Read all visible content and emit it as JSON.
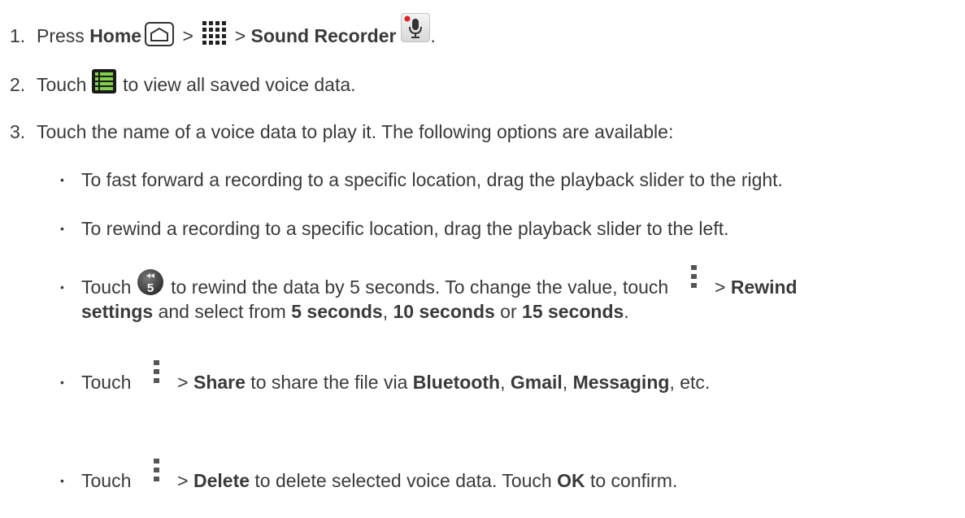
{
  "steps": [
    {
      "num": "1.",
      "t1": "Press ",
      "b1": "Home",
      "t2": " > ",
      "t3": " > ",
      "b2": "Sound Recorder",
      "t4": "."
    },
    {
      "num": "2.",
      "t1": "Touch ",
      "t2": " to view all saved voice data."
    },
    {
      "num": "3.",
      "t1": "Touch the name of a voice data to play it. The following options are available:"
    }
  ],
  "bullet_glyph": "•",
  "bullets": [
    {
      "t1": "To fast forward a recording to a specific location, drag the playback slider to the right."
    },
    {
      "t1": "To rewind a recording to a specific location, drag the playback slider to the left."
    },
    {
      "t1": "Touch ",
      "t2": " to rewind the data by 5 seconds. To change the value, touch ",
      "t3": " > ",
      "b1": "Rewind",
      "b2": "settings",
      "t4": " and select from ",
      "b3": "5 seconds",
      "t5": ", ",
      "b4": "10 seconds",
      "t6": " or ",
      "b5": "15 seconds",
      "t7": "."
    },
    {
      "t1": "Touch ",
      "t2": " > ",
      "b1": "Share",
      "t3": " to share the file via ",
      "b2": "Bluetooth",
      "t4": ", ",
      "b3": "Gmail",
      "t5": ", ",
      "b4": "Messaging",
      "t6": ", etc."
    },
    {
      "t1": "Touch ",
      "t2": " > ",
      "b1": "Delete",
      "t3": " to delete selected voice data. Touch ",
      "b2": "OK",
      "t4": " to confirm."
    }
  ],
  "icons": {
    "home": "home-icon",
    "apps": "apps-grid-icon",
    "sound_recorder": "microphone-icon",
    "list": "list-icon",
    "rewind": "rewind-5-seconds-icon",
    "menu": "menu-icon"
  },
  "colors": {
    "text": "#3a3a3a",
    "mic_dot": "#e02020"
  },
  "rewind_icon_label": "5"
}
